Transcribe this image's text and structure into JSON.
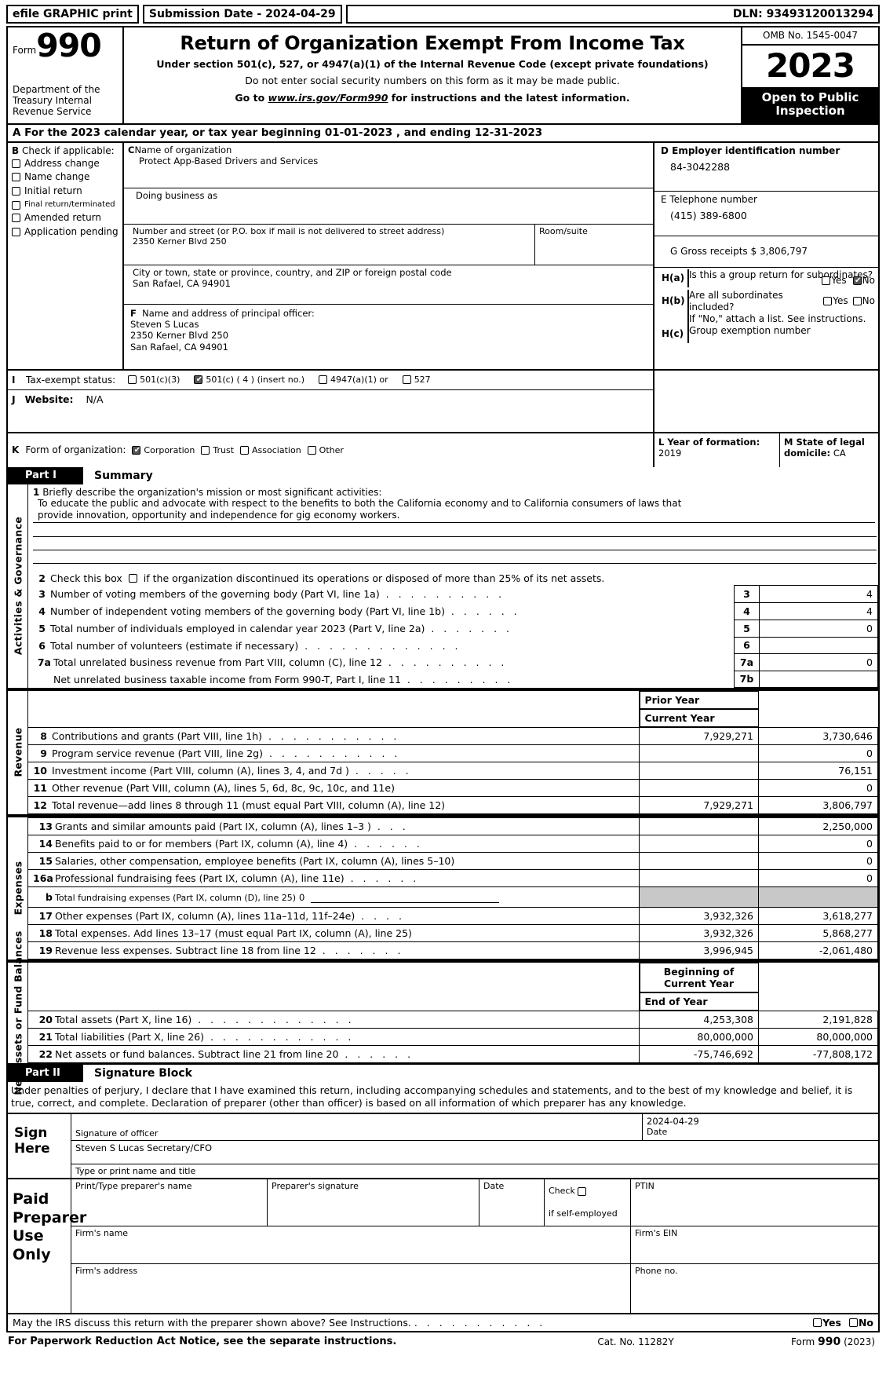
{
  "efile": {
    "print_label": "efile GRAPHIC print",
    "submission_date": "Submission Date - 2024-04-29",
    "dln": "DLN: 93493120013294"
  },
  "header": {
    "form_label": "Form",
    "form_number": "990",
    "department": "Department of the Treasury Internal Revenue Service",
    "title": "Return of Organization Exempt From Income Tax",
    "subtitle1": "Under section 501(c), 527, or 4947(a)(1) of the Internal Revenue Code (except private foundations)",
    "subtitle2": "Do not enter social security numbers on this form as it may be made public.",
    "subtitle3_pre": "Go to ",
    "subtitle3_link": "www.irs.gov/Form990",
    "subtitle3_post": " for instructions and the latest information.",
    "omb": "OMB No. 1545-0047",
    "tax_year": "2023",
    "open_to_public": "Open to Public Inspection"
  },
  "line_a": {
    "label": "A",
    "text": "For the 2023 calendar year, or tax year beginning 01-01-2023    , and ending 12-31-2023"
  },
  "section_b": {
    "letter": "B",
    "heading": "Check if applicable:",
    "options": [
      {
        "label": "Address change",
        "checked": false
      },
      {
        "label": "Name change",
        "checked": false
      },
      {
        "label": "Initial return",
        "checked": false
      },
      {
        "label": "Final return/terminated",
        "checked": false
      },
      {
        "label": "Amended return",
        "checked": false
      },
      {
        "label": "Application pending",
        "checked": false
      }
    ]
  },
  "section_c": {
    "letter": "C",
    "name_label": "Name of organization",
    "name_value": "Protect App-Based Drivers and Services",
    "dba_label": "Doing business as",
    "dba_value": "",
    "street_label": "Number and street (or P.O. box if mail is not delivered to street address)",
    "street_value": "2350 Kerner Blvd 250",
    "room_label": "Room/suite",
    "room_value": "",
    "city_label": "City or town, state or province, country, and ZIP or foreign postal code",
    "city_value": "San Rafael, CA   94901"
  },
  "section_f": {
    "letter": "F",
    "label": "Name and address of principal officer:",
    "line1": "Steven S Lucas",
    "line2": "2350 Kerner Blvd 250",
    "line3": "San Rafael, CA   94901"
  },
  "section_d": {
    "label": "D Employer identification number",
    "value": "84-3042288"
  },
  "section_e": {
    "label": "E Telephone number",
    "value": "(415) 389-6800"
  },
  "section_g": {
    "label": "G Gross receipts $",
    "value": "3,806,797"
  },
  "section_h": {
    "ha_key": "H(a)",
    "ha_text": "Is this a group return for subordinates?",
    "ha_yes": "Yes",
    "ha_no": "No",
    "ha_yes_checked": false,
    "ha_no_checked": true,
    "hb_key": "H(b)",
    "hb_text": "Are all subordinates included?",
    "hb_yes": "Yes",
    "hb_no": "No",
    "hb_yes_checked": false,
    "hb_no_checked": false,
    "attach_note": "If \"No,\" attach a list. See instructions.",
    "hc_key": "H(c)",
    "hc_text": "Group exemption number",
    "hc_value": ""
  },
  "section_i": {
    "letter": "I",
    "label": "Tax-exempt status:",
    "options": [
      {
        "label": "501(c)(3)",
        "checked": false
      },
      {
        "label": "501(c) ( 4 ) (insert no.)",
        "checked": true
      },
      {
        "label": "4947(a)(1) or",
        "checked": false
      },
      {
        "label": "527",
        "checked": false
      }
    ]
  },
  "section_j": {
    "letter": "J",
    "label": "Website:",
    "value": "N/A"
  },
  "section_k": {
    "letter": "K",
    "label": "Form of organization:",
    "options": [
      {
        "label": "Corporation",
        "checked": true
      },
      {
        "label": "Trust",
        "checked": false
      },
      {
        "label": "Association",
        "checked": false
      },
      {
        "label": "Other",
        "checked": false
      }
    ]
  },
  "section_l": {
    "label": "L Year of formation:",
    "value": "2019"
  },
  "section_m": {
    "label": "M State of legal domicile:",
    "value": "CA"
  },
  "part1": {
    "part_label": "Part I",
    "part_title": "Summary",
    "vtab_activities": "Activities & Governance",
    "vtab_revenue": "Revenue",
    "vtab_expenses": "Expenses",
    "vtab_netassets": "Net Assets or Fund Balances",
    "line1_num": "1",
    "line1_label": "Briefly describe the organization's mission or most significant activities:",
    "mission_line1": "To educate the public and advocate with respect to the benefits to both the California economy and to California consumers of laws that",
    "mission_line2": "provide innovation, opportunity and independence for gig economy workers.",
    "line2_num": "2",
    "line2_text_a": "Check this box",
    "line2_text_b": "if the organization discontinued its operations or disposed of more than 25% of its net assets.",
    "line2_checked": false,
    "governance_rows": [
      {
        "num": "3",
        "key": "3",
        "label": "Number of voting members of the governing body (Part VI, line 1a)",
        "dots": ".  .  .  .  .  .  .  .  .  .",
        "value": "4"
      },
      {
        "num": "4",
        "key": "4",
        "label": "Number of independent voting members of the governing body (Part VI, line 1b)",
        "dots": ".  .  .  .  .  .",
        "value": "4"
      },
      {
        "num": "5",
        "key": "5",
        "label": "Total number of individuals employed in calendar year 2023 (Part V, line 2a)",
        "dots": ".  .  .  .  .  .  .",
        "value": "0"
      },
      {
        "num": "6",
        "key": "6",
        "label": "Total number of volunteers (estimate if necessary)",
        "dots": ".  .  .  .  .  .  .  .  .  .  .  .  .",
        "value": ""
      },
      {
        "num": "7a",
        "key": "7a",
        "label": "Total unrelated business revenue from Part VIII, column (C), line 12",
        "dots": ".  .  .  .  .  .  .  .  .  .",
        "value": "0"
      },
      {
        "num": "",
        "key": "7b",
        "label": "Net unrelated business taxable income from Form 990-T, Part I, line 11",
        "dots": ".  .  .  .  .  .  .  .  .",
        "value": ""
      }
    ],
    "col_prior": "Prior Year",
    "col_current": "Current Year",
    "revenue_rows": [
      {
        "num": "8",
        "label": "Contributions and grants (Part VIII, line 1h)",
        "dots": ".  .  .  .  .  .  .  .  .  .  .",
        "prior": "7,929,271",
        "current": "3,730,646"
      },
      {
        "num": "9",
        "label": "Program service revenue (Part VIII, line 2g)",
        "dots": ".  .  .  .  .  .  .  .  .  .  .",
        "prior": "",
        "current": "0"
      },
      {
        "num": "10",
        "label": "Investment income (Part VIII, column (A), lines 3, 4, and 7d )",
        "dots": ".  .  .  .  .",
        "prior": "",
        "current": "76,151"
      },
      {
        "num": "11",
        "label": "Other revenue (Part VIII, column (A), lines 5, 6d, 8c, 9c, 10c, and 11e)",
        "dots": "",
        "prior": "",
        "current": "0"
      },
      {
        "num": "12",
        "label": "Total revenue—add lines 8 through 11 (must equal Part VIII, column (A), line 12)",
        "dots": "",
        "prior": "7,929,271",
        "current": "3,806,797"
      }
    ],
    "expense_rows": [
      {
        "num": "13",
        "label": "Grants and similar amounts paid (Part IX, column (A), lines 1–3 )",
        "dots": ".   .   .",
        "prior": "",
        "current": "2,250,000"
      },
      {
        "num": "14",
        "label": "Benefits paid to or for members (Part IX, column (A), line 4)",
        "dots": ".  .  .  .  .  .",
        "prior": "",
        "current": "0"
      },
      {
        "num": "15",
        "label": "Salaries, other compensation, employee benefits (Part IX, column (A), lines 5–10)",
        "dots": "",
        "prior": "",
        "current": "0"
      },
      {
        "num": "16a",
        "label": "Professional fundraising fees (Part IX, column (A), line 11e)",
        "dots": ".  .  .  .  .  .",
        "prior": "",
        "current": "0"
      }
    ],
    "fundraising_num": "b",
    "fundraising_label": "Total fundraising expenses (Part IX, column (D), line 25)",
    "fundraising_value": "0",
    "expense_rows2": [
      {
        "num": "17",
        "label": "Other expenses (Part IX, column (A), lines 11a–11d, 11f–24e)",
        "dots": ".   .   .   .",
        "prior": "3,932,326",
        "current": "3,618,277"
      },
      {
        "num": "18",
        "label": "Total expenses. Add lines 13–17 (must equal Part IX, column (A), line 25)",
        "dots": "",
        "prior": "3,932,326",
        "current": "5,868,277"
      },
      {
        "num": "19",
        "label": "Revenue less expenses. Subtract line 18 from line 12",
        "dots": ".   .   .   .   .   .   .",
        "prior": "3,996,945",
        "current": "-2,061,480"
      }
    ],
    "col_begin": "Beginning of Current Year",
    "col_end": "End of Year",
    "netasset_rows": [
      {
        "num": "20",
        "label": "Total assets (Part X, line 16)",
        "dots": ".   .   .   .   .   .   .   .   .   .   .   .   .",
        "begin": "4,253,308",
        "end": "2,191,828"
      },
      {
        "num": "21",
        "label": "Total liabilities (Part X, line 26)",
        "dots": ".   .   .   .   .   .   .   .   .   .   .   .",
        "begin": "80,000,000",
        "end": "80,000,000"
      },
      {
        "num": "22",
        "label": "Net assets or fund balances. Subtract line 21 from line 20",
        "dots": ".   .   .   .   .   .",
        "begin": "-75,746,692",
        "end": "-77,808,172"
      }
    ]
  },
  "part2": {
    "part_label": "Part II",
    "part_title": "Signature Block",
    "perjury": "Under penalties of perjury, I declare that I have examined this return, including accompanying schedules and statements, and to the best of my knowledge and belief, it is true, correct, and complete. Declaration of preparer (other than officer) is based on all information of which preparer has any knowledge.",
    "sign_here_1": "Sign",
    "sign_here_2": "Here",
    "sig_officer_label": "Signature of officer",
    "date_label": "Date",
    "date_value": "2024-04-29",
    "name_title_value": "Steven S Lucas  Secretary/CFO",
    "name_title_label": "Type or print name and title"
  },
  "preparer": {
    "label_1": "Paid",
    "label_2": "Preparer",
    "label_3": "Use Only",
    "col_name": "Print/Type preparer's name",
    "col_sig": "Preparer's signature",
    "col_date": "Date",
    "check_pre": "Check",
    "check_post": "if self-employed",
    "check_checked": false,
    "col_ptin": "PTIN",
    "firm_name_label": "Firm's name",
    "firm_ein_label": "Firm's EIN",
    "firm_addr_label": "Firm's address",
    "phone_label": "Phone no.",
    "firm_name_value": "",
    "firm_ein_value": "",
    "firm_addr_value": "",
    "phone_value": "",
    "prep_name_value": "",
    "prep_sig_value": "",
    "prep_date_value": "",
    "ptin_value": ""
  },
  "irs_question": {
    "text": "May the IRS discuss this return with the preparer shown above? See Instructions.",
    "dots": ".   .   .   .   .   .   .   .   .   .   .",
    "yes": "Yes",
    "no": "No",
    "yes_checked": false,
    "no_checked": false
  },
  "footer": {
    "paperwork": "For Paperwork Reduction Act Notice, see the separate instructions.",
    "cat_no": "Cat. No. 11282Y",
    "form_pre": "Form ",
    "form_num": "990",
    "form_year": " (2023)"
  }
}
